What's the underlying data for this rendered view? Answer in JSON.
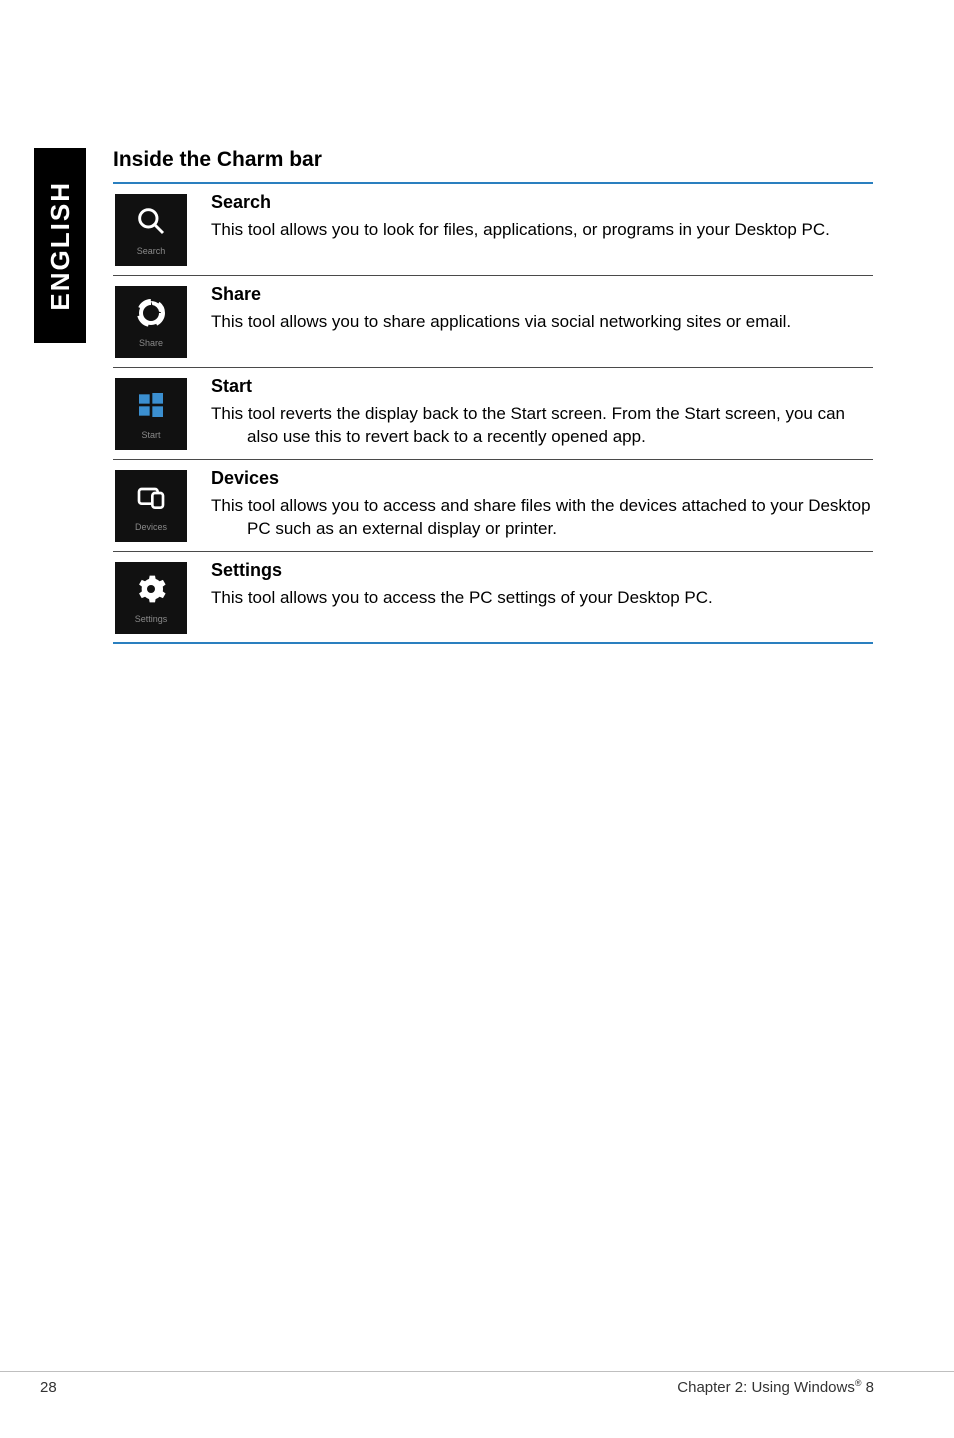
{
  "sideTab": "ENGLISH",
  "sectionTitle": "Inside the Charm bar",
  "rows": [
    {
      "iconLabel": "Search",
      "heading": "Search",
      "desc": "This tool allows you to look for files, applications, or programs in your Desktop PC."
    },
    {
      "iconLabel": "Share",
      "heading": "Share",
      "desc": "This tool allows you to share applications via social networking sites or email."
    },
    {
      "iconLabel": "Start",
      "heading": "Start",
      "desc": "This tool reverts the display back to the Start screen. From the Start screen, you can also use this to revert back to a recently opened app."
    },
    {
      "iconLabel": "Devices",
      "heading": "Devices",
      "desc": "This tool allows you to access and share files with the devices attached to your Desktop PC such as an external display or printer."
    },
    {
      "iconLabel": "Settings",
      "heading": "Settings",
      "desc": "This tool allows you to access the PC settings of your Desktop PC."
    }
  ],
  "footer": {
    "pageNumber": "28",
    "chapterPrefix": "Chapter 2: Using Windows",
    "chapterSuffix": " 8"
  }
}
